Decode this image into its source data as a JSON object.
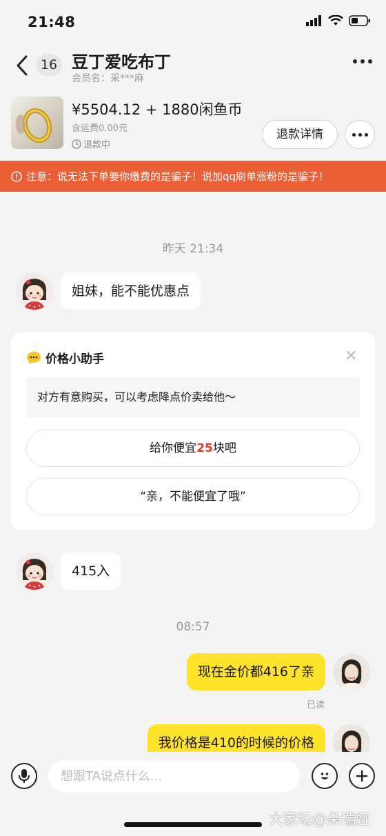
{
  "status_bar": {
    "time": "21:48"
  },
  "header": {
    "unread_count": "16",
    "title": "豆丁爱吃布丁",
    "member_name": "会员名：采***麻"
  },
  "product": {
    "price": "¥5504.12 + 1880闲鱼币",
    "shipping": "含运费0.00元",
    "status": "退款中",
    "refund_button": "退款详情"
  },
  "warning": {
    "text": "注意：说无法下单要你缴费的是骗子！说加qq刷单涨粉的是骗子！"
  },
  "messages": {
    "time1": "昨天 21:34",
    "msg1": "姐妹，能不能优惠点",
    "msg2": "415入",
    "time2": "08:57",
    "msg3": "现在金价都416了亲",
    "read": "已读",
    "msg4": "我价格是410的时候的价格"
  },
  "helper": {
    "title": "价格小助手",
    "hint": "对方有意购买，可以考虑降点价卖给他～",
    "option1_prefix": "给你便宜",
    "option1_amount": "25",
    "option1_suffix": "块吧",
    "option2": "“亲，不能便宜了哦”"
  },
  "input": {
    "placeholder": "想跟TA说点什么..."
  },
  "watermark": "大家坛@朵瑞娅",
  "colors": {
    "accent_yellow": "#ffe32b",
    "warning_orange": "#ec5e35",
    "highlight_red": "#e63b2e",
    "background": "#f4f4f4"
  }
}
